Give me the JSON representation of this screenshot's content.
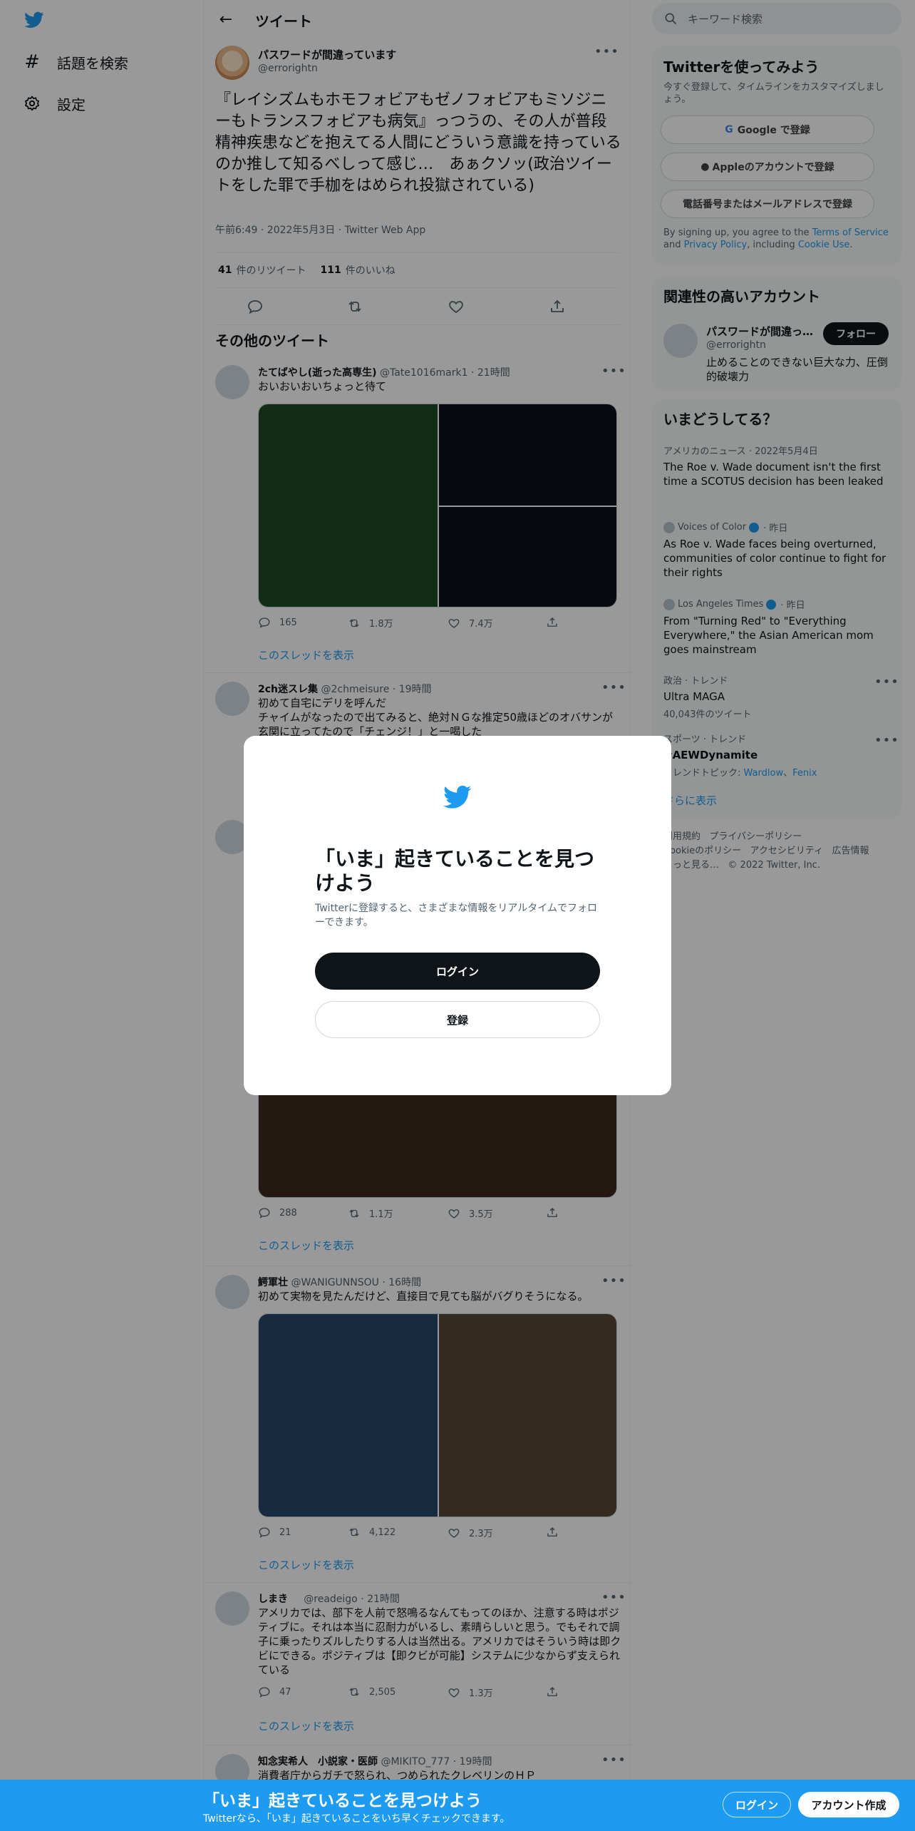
{
  "nav": {
    "items": [
      {
        "icon": "hashtag-icon",
        "label": "話題を検索"
      },
      {
        "icon": "gear-icon",
        "label": "設定"
      }
    ]
  },
  "header": {
    "title": "ツイート"
  },
  "focal": {
    "name": "パスワードが間違っています",
    "handle": "@errorightn",
    "text": "『レイシズムもホモフォビアもゼノフォビアもミソジニーもトランスフォビアも病気』っつうの、その人が普段精神疾患などを抱えてる人間にどういう意識を持っているのか推して知るべしって感じ…　あぁクソッ(政治ツイートをした罪で手枷をはめられ投獄されている)",
    "meta": "午前6:49 · 2022年5月3日 · Twitter Web App",
    "retweets_count": "41",
    "retweets_label": "件のリツイート",
    "likes_count": "111",
    "likes_label": "件のいいね"
  },
  "section_title": "その他のツイート",
  "tweets": [
    {
      "name": "たてばやし(逝った高専生)",
      "handle": "@Tate1016mark1",
      "time": "21時間",
      "text": "おいおいおいちょっと待て",
      "replies": "165",
      "retweets": "1.8万",
      "likes": "7.4万",
      "thread": "このスレッドを表示"
    },
    {
      "name": "2ch迷スレ集",
      "handle": "@2chmeisure",
      "time": "19時間",
      "text": "初めて自宅にデリを呼んだ\nチャイムがなったので出てみると、絶対ＮＧな推定50歳ほどのオバサンが玄関に立ってたので「チェンジ！」と一喝した",
      "replies": "288",
      "retweets": "1.1万",
      "likes": "3.5万",
      "thread": "このスレッドを表示"
    },
    {
      "name": "鰐軍壮",
      "handle": "@WANIGUNNSOU",
      "time": "16時間",
      "text": "初めて実物を見たんだけど、直接目で見ても脳がバグりそうになる。",
      "replies": "21",
      "retweets": "4,122",
      "likes": "2.3万",
      "thread": "このスレッドを表示"
    },
    {
      "name": "しまき",
      "handle": "@readeigo",
      "time": "21時間",
      "text": "アメリカでは、部下を人前で怒鳴るなんてもってのほか、注意する時はポジティブに。それは本当に忍耐力がいるし、素晴らしいと思う。でもそれで調子に乗ったりズルしたりする人は当然出る。アメリカではそういう時は即クビにできる。ポジティブは【即クビが可能】システムに少なからず支えられている",
      "replies": "47",
      "retweets": "2,505",
      "likes": "1.3万",
      "thread": "このスレッドを表示"
    },
    {
      "name": "知念実希人　小説家・医師",
      "handle": "@MIKITO_777",
      "time": "19時間",
      "text": "消費者庁からガチで怒られ、つめられたクレベリンのＨＰ"
    }
  ],
  "search": {
    "placeholder": "キーワード検索"
  },
  "signup_card": {
    "title": "Twitterを使ってみよう",
    "subtitle": "今すぐ登録して、タイムラインをカスタマイズしましょう。",
    "google": "Google で登録",
    "apple": "Appleのアカウントで登録",
    "phone": "電話番号またはメールアドレスで登録",
    "legal_1": "By signing up, you agree to the ",
    "terms": "Terms of Service",
    "legal_2": " and ",
    "privacy": "Privacy Policy",
    "legal_3": ", including ",
    "cookie": "Cookie Use",
    "legal_4": "."
  },
  "related": {
    "title": "関連性の高いアカウント",
    "name": "パスワードが間違っ…",
    "handle": "@errorightn",
    "bio": "止めることのできない巨大な力、圧倒的破壊力",
    "follow": "フォロー"
  },
  "trends": {
    "title": "いまどうしてる？",
    "items": [
      {
        "meta": "アメリカのニュース · 2022年5月4日",
        "title": "The Roe v. Wade document isn't the first time a SCOTUS decision has been leaked"
      },
      {
        "source": "Voices of Color",
        "time": "· 昨日",
        "title": "As Roe v. Wade faces being overturned, communities of color continue to fight for their rights"
      },
      {
        "source": "Los Angeles Times",
        "time": "· 昨日",
        "title": "From \"Turning Red\" to \"Everything Everywhere,\" the Asian American mom goes mainstream"
      },
      {
        "meta": "政治 · トレンド",
        "title": "Ultra MAGA",
        "sub": "40,043件のツイート"
      },
      {
        "meta": "スポーツ · トレンド",
        "title": "#AEWDynamite",
        "sub_prefix": "トレンドトピック: ",
        "link1": "Wardlow",
        "sep": "、",
        "link2": "Fenix"
      }
    ],
    "show_more": "さらに表示"
  },
  "footer": {
    "terms": "利用規約",
    "privacy": "プライバシーポリシー",
    "cookie": "Cookieのポリシー",
    "accessibility": "アクセシビリティ",
    "ads": "広告情報",
    "more": "もっと見る…",
    "copyright": "© 2022 Twitter, Inc."
  },
  "modal": {
    "title": "「いま」起きていることを見つけよう",
    "subtitle": "Twitterに登録すると、さまざまな情報をリアルタイムでフォローできます。",
    "login": "ログイン",
    "signup": "登録"
  },
  "bottom_bar": {
    "title": "「いま」起きていることを見つけよう",
    "subtitle": "Twitterなら、「いま」起きていることをいち早くチェックできます。",
    "login": "ログイン",
    "signup": "アカウント作成"
  },
  "colors": {
    "brand": "#1d9bf0",
    "text": "#0f1419",
    "muted": "#536471"
  }
}
